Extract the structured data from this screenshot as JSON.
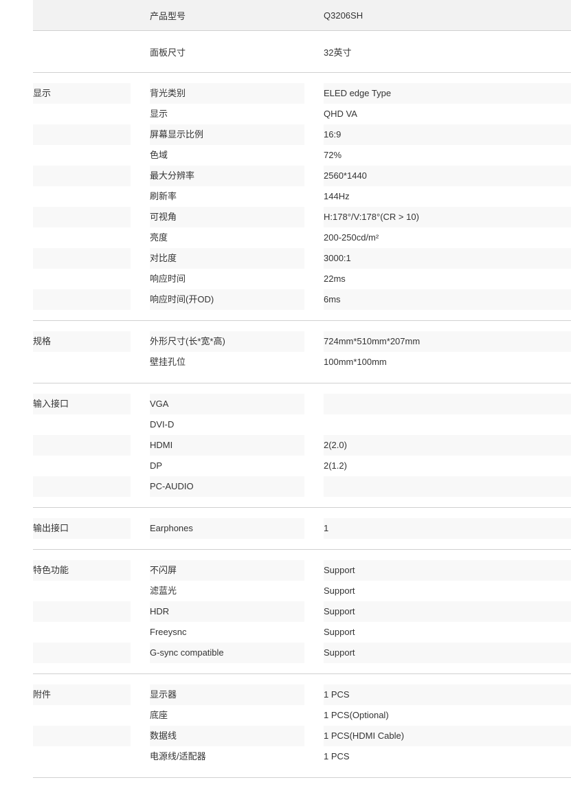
{
  "header_rows": [
    {
      "label": "产品型号",
      "value": "Q3206SH"
    },
    {
      "label": "面板尺寸",
      "value": "32英寸"
    }
  ],
  "sections": [
    {
      "title": "显示",
      "rows": [
        {
          "label": "背光类别",
          "value": "ELED edge Type"
        },
        {
          "label": "显示",
          "value": "QHD VA"
        },
        {
          "label": "屏幕显示比例",
          "value": "16:9"
        },
        {
          "label": "色域",
          "value": "72%"
        },
        {
          "label": "最大分辨率",
          "value": "2560*1440"
        },
        {
          "label": "刷新率",
          "value": "144Hz"
        },
        {
          "label": "可视角",
          "value": "H:178°/V:178°(CR > 10)"
        },
        {
          "label": "亮度",
          "value": "200-250cd/m²"
        },
        {
          "label": "对比度",
          "value": "3000:1"
        },
        {
          "label": "响应时间",
          "value": "22ms"
        },
        {
          "label": "响应时间(开OD)",
          "value": "6ms"
        }
      ]
    },
    {
      "title": "规格",
      "rows": [
        {
          "label": "外形尺寸(长*宽*高)",
          "value": "724mm*510mm*207mm"
        },
        {
          "label": "壁挂孔位",
          "value": "100mm*100mm"
        }
      ]
    },
    {
      "title": "输入接口",
      "rows": [
        {
          "label": "VGA",
          "value": ""
        },
        {
          "label": "DVI-D",
          "value": ""
        },
        {
          "label": "HDMI",
          "value": "2(2.0)"
        },
        {
          "label": "DP",
          "value": "2(1.2)"
        },
        {
          "label": "PC-AUDIO",
          "value": ""
        }
      ]
    },
    {
      "title": "输出接口",
      "rows": [
        {
          "label": "Earphones",
          "value": "1"
        }
      ]
    },
    {
      "title": "特色功能",
      "rows": [
        {
          "label": "不闪屏",
          "value": "Support"
        },
        {
          "label": "滤蓝光",
          "value": "Support"
        },
        {
          "label": "HDR",
          "value": "Support"
        },
        {
          "label": "Freeysnc",
          "value": "Support"
        },
        {
          "label": "G-sync compatible",
          "value": "Support"
        }
      ]
    },
    {
      "title": "附件",
      "rows": [
        {
          "label": "显示器",
          "value": "1 PCS"
        },
        {
          "label": "底座",
          "value": "1 PCS(Optional)"
        },
        {
          "label": "数据线",
          "value": "1 PCS(HDMI Cable)"
        },
        {
          "label": "电源线/适配器",
          "value": "1 PCS"
        }
      ]
    }
  ]
}
